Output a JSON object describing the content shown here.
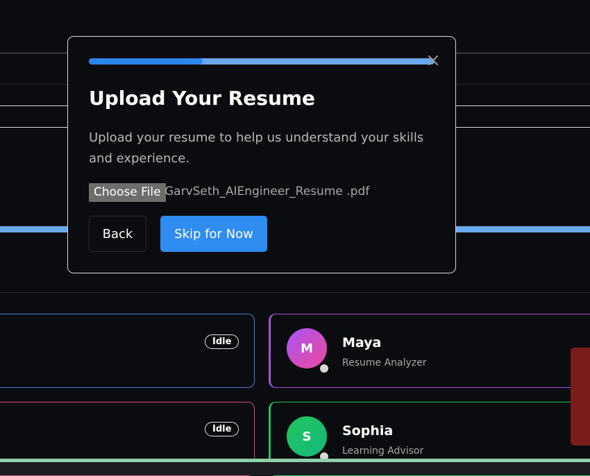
{
  "modal": {
    "title": "Upload Your Resume",
    "description": "Upload your resume to help us understand your skills and experience.",
    "progress": 0.33,
    "file_button_label": "Choose File",
    "file_name": "GarvSeth_AIEngineer_Resume .pdf",
    "back_label": "Back",
    "skip_label": "Skip for Now",
    "close_icon": "close-icon"
  },
  "agents": {
    "left": [
      {
        "status": "Idle"
      },
      {
        "status": "Idle"
      }
    ],
    "right": [
      {
        "initial": "M",
        "name": "Maya",
        "role": "Resume Analyzer",
        "accent": "#a84fe0"
      },
      {
        "initial": "S",
        "name": "Sophia",
        "role": "Learning Advisor",
        "accent": "#22c55e"
      }
    ]
  },
  "colors": {
    "background": "#0b0c0f",
    "primary": "#2f8cf0",
    "progress_track": "#69a9ef"
  }
}
